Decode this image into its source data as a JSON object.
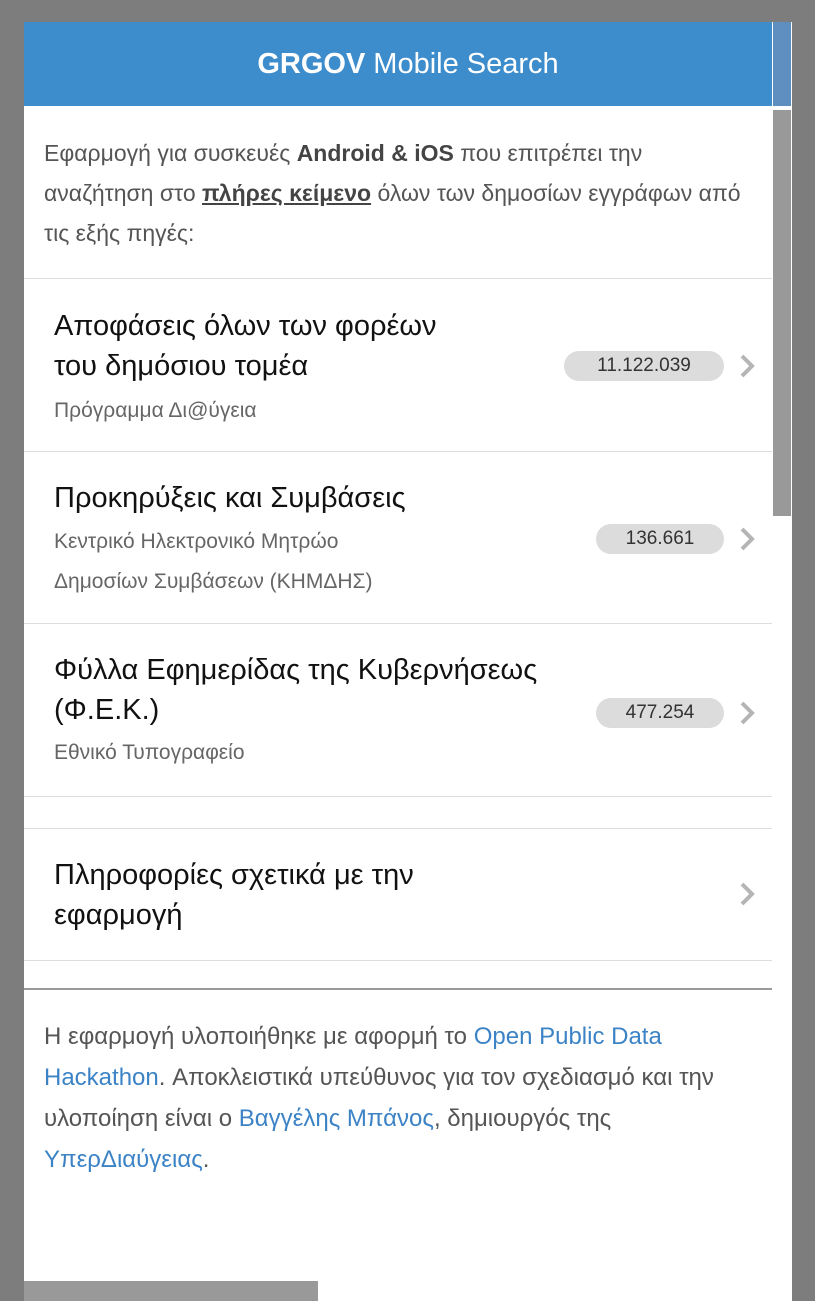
{
  "header": {
    "brand": "GRGOV",
    "title": "Mobile Search"
  },
  "intro": {
    "t1": "Εφαρμογή για συσκευές ",
    "t2": "Android & iOS",
    "t3": " που επιτρέπει την αναζήτηση στο ",
    "t4": "πλήρες κείμενο",
    "t5": " όλων των δημοσίων εγγράφων από τις εξής πηγές:"
  },
  "sources": [
    {
      "title_line1": "Αποφάσεις όλων των φορέων",
      "title_line2": "του δημόσιου τομέα",
      "subtitle": "Πρόγραμμα Δι@ύγεια",
      "count": "11.122.039"
    },
    {
      "title_line1": "Προκηρύξεις και Συμβάσεις",
      "subtitle_line1": "Κεντρικό Ηλεκτρονικό Μητρώο",
      "subtitle_line2": "Δημοσίων Συμβάσεων (ΚΗΜΔΗΣ)",
      "count": "136.661"
    },
    {
      "title_line1": "Φύλλα Εφημερίδας της Κυβερνήσεως",
      "title_line2": "(Φ.Ε.Κ.)",
      "subtitle": "Εθνικό Τυπογραφείο",
      "count": "477.254"
    }
  ],
  "about": {
    "title_line1": "Πληροφορίες σχετικά με την",
    "title_line2": "εφαρμογή"
  },
  "footer": {
    "t1": "Η εφαρμογή υλοποιήθηκε με αφορμή το ",
    "link1": "Open Public Data Hackathon",
    "t2": ". Αποκλειστικά υπεύθυνος για τον σχεδιασμό και την υλοποίηση είναι ο ",
    "link2": "Βαγγέλης Μπάνος",
    "t3": ", δημιουργός της ",
    "link3": "ΥπερΔιαύγειας",
    "t4": "."
  },
  "colors": {
    "header_bg": "#3d8ccc",
    "link": "#3c83c6",
    "badge_bg": "#dcdcdc"
  },
  "icons": {
    "chevron": "chevron-right-icon"
  }
}
